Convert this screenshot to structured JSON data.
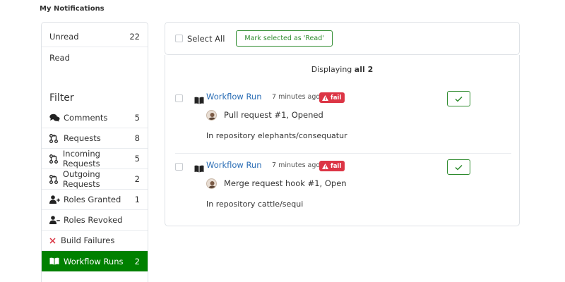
{
  "page_title": "My Notifications",
  "sidebar": {
    "status_items": [
      {
        "label": "Unread",
        "count": "22"
      },
      {
        "label": "Read",
        "count": ""
      }
    ],
    "filter_title": "Filter",
    "filter_items": [
      {
        "label": "Comments",
        "count": "5",
        "icon": "comments-icon"
      },
      {
        "label": "Requests",
        "count": "8",
        "icon": "pull-request-icon"
      },
      {
        "label": "Incoming Requests",
        "count": "5",
        "icon": "pull-request-icon"
      },
      {
        "label": "Outgoing Requests",
        "count": "2",
        "icon": "pull-request-icon"
      },
      {
        "label": "Roles Granted",
        "count": "1",
        "icon": "user-plus-icon"
      },
      {
        "label": "Roles Revoked",
        "count": "",
        "icon": "user-minus-icon"
      },
      {
        "label": "Build Failures",
        "count": "",
        "icon": "x-icon"
      },
      {
        "label": "Workflow Runs",
        "count": "2",
        "icon": "book-icon",
        "active": true
      }
    ]
  },
  "toolbar": {
    "select_all_label": "Select All",
    "mark_read_label": "Mark selected as 'Read'"
  },
  "list": {
    "displaying_prefix": "Displaying ",
    "displaying_count": "all 2",
    "notifications": [
      {
        "title": "Workflow Run",
        "time": "7 minutes ago",
        "badge": "fail",
        "subject": "Pull request #1, Opened",
        "repo": "In repository elephants/consequatur"
      },
      {
        "title": "Workflow Run",
        "time": "7 minutes ago",
        "badge": "fail",
        "subject": "Merge request hook #1, Open",
        "repo": "In repository cattle/sequi"
      }
    ]
  },
  "colors": {
    "active_bg": "#008000",
    "link": "#2a6db5",
    "fail_badge": "#dc3545",
    "accent_green": "#2e8b2e"
  }
}
